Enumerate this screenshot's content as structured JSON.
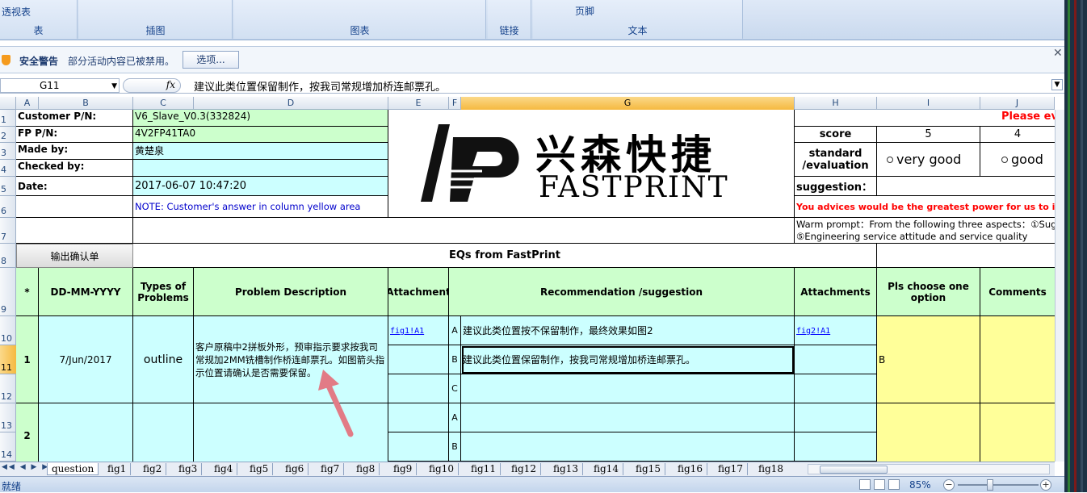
{
  "ribbon": {
    "groups": [
      {
        "label": "表",
        "cmd": "透视表"
      },
      {
        "label": "插图",
        "cmd": ""
      },
      {
        "label": "图表",
        "cmd": ""
      },
      {
        "label": "链接",
        "cmd": ""
      },
      {
        "label": "文本",
        "cmd": "页脚"
      }
    ]
  },
  "security_bar": {
    "title": "安全警告",
    "message": "部分活动内容已被禁用。",
    "options_button": "选项..."
  },
  "formula_bar": {
    "name_box": "G11",
    "fx": "fx",
    "formula": "建议此类位置保留制作，按我司常规增加桥连邮票孔。"
  },
  "columns": [
    "A",
    "B",
    "C",
    "D",
    "E",
    "F",
    "G",
    "H",
    "I",
    "J"
  ],
  "rows": [
    "1",
    "2",
    "3",
    "4",
    "5",
    "6",
    "7",
    "8",
    "9",
    "10",
    "11",
    "12",
    "13",
    "14"
  ],
  "header_info": {
    "customer_pn_label": "Customer P/N:",
    "customer_pn": "V6_Slave_V0.3(332824)",
    "fp_pn_label": "FP P/N:",
    "fp_pn": "4V2FP41TA0",
    "made_by_label": "Made by:",
    "made_by": "黄楚泉",
    "checked_by_label": "Checked by:",
    "checked_by": "",
    "date_label": "Date:",
    "date": "2017-06-07 10:47:20",
    "note": "NOTE: Customer's  answer in column yellow area"
  },
  "logo": {
    "cn": "兴森快捷",
    "en": "FASTPRINT"
  },
  "evaluation": {
    "please": "Please ev",
    "score_label": "score",
    "score_5": "5",
    "score_4": "4",
    "standard_label": "standard /evaluation",
    "opt_5": "very good",
    "opt_4": "good",
    "suggestion_label": "suggestion：",
    "advice": "You advices would be the greatest power for us to improv",
    "warm1": "Warm prompt：From the following three aspects：①Sugg",
    "warm2": "⑤Engineering service attitude and service quality"
  },
  "export_button": "输出确认单",
  "eq_title": "EQs from FastPrint",
  "table_headers": {
    "star": "*",
    "date": "DD-MM-YYYY",
    "types": "Types of Problems",
    "problem": "Problem Description",
    "attachment": "Attachment",
    "recommendation": "Recommendation /suggestion",
    "attachments": "Attachments",
    "choose": "Pls choose one option",
    "comments": "Comments"
  },
  "eq1": {
    "num": "1",
    "date": "7/Jun/2017",
    "type": "outline",
    "description": "客户原稿中2拼板外形，预审指示要求按我司常规加2MM铣槽制作桥连邮票孔。如图箭头指示位置请确认是否需要保留。",
    "attachment": "fig1!A1",
    "options": [
      {
        "key": "A",
        "text": "建议此类位置按不保留制作，最终效果如图2",
        "attach": "fig2!A1"
      },
      {
        "key": "B",
        "text": "建议此类位置保留制作，按我司常规增加桥连邮票孔。",
        "attach": ""
      },
      {
        "key": "C",
        "text": "",
        "attach": ""
      }
    ],
    "choice": "B"
  },
  "eq2": {
    "num": "2",
    "options": [
      {
        "key": "A"
      },
      {
        "key": "B"
      }
    ]
  },
  "sheet_tabs": [
    "question",
    "fig1",
    "fig2",
    "fig3",
    "fig4",
    "fig5",
    "fig6",
    "fig7",
    "fig8",
    "fig9",
    "fig10",
    "fig11",
    "fig12",
    "fig13",
    "fig14",
    "fig15",
    "fig16",
    "fig17",
    "fig18"
  ],
  "status": {
    "ready": "就绪",
    "zoom": "85%"
  }
}
